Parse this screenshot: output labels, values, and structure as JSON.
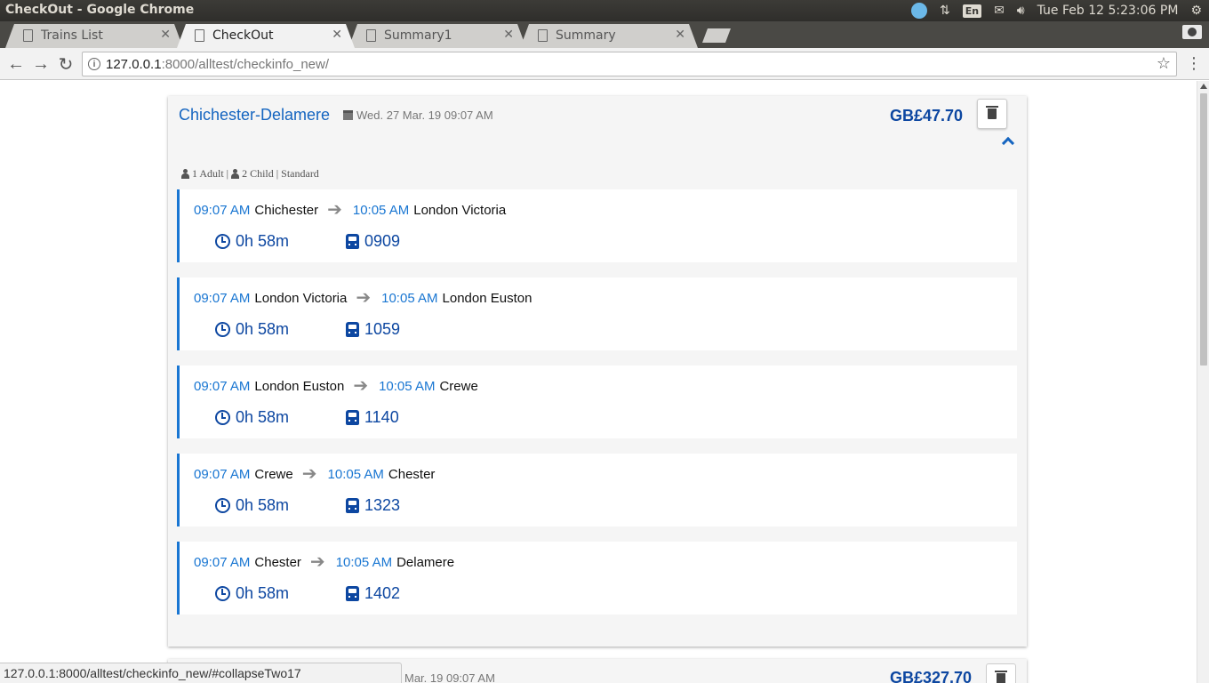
{
  "window": {
    "title": "CheckOut - Google Chrome"
  },
  "system_tray": {
    "lang": "En",
    "datetime": "Tue Feb 12  5:23:06 PM"
  },
  "tabs": [
    {
      "label": "Trains List",
      "active": false
    },
    {
      "label": "CheckOut",
      "active": true
    },
    {
      "label": "Summary1",
      "active": false
    },
    {
      "label": "Summary",
      "active": false
    }
  ],
  "toolbar": {
    "url_host": "127.0.0.1",
    "url_rest": ":8000/alltest/checkinfo_new/"
  },
  "booking": {
    "route": "Chichester-Delamere",
    "date": "Wed. 27 Mar. 19 09:07 AM",
    "price": "GB£47.70",
    "passengers": {
      "adult": "1 Adult |",
      "child": "2 Child | Standard"
    },
    "legs": [
      {
        "dep_time": "09:07 AM",
        "from": "Chichester",
        "arr_time": "10:05 AM",
        "to": "London Victoria",
        "duration": "0h 58m",
        "train": "0909"
      },
      {
        "dep_time": "09:07 AM",
        "from": "London Victoria",
        "arr_time": "10:05 AM",
        "to": "London Euston",
        "duration": "0h 58m",
        "train": "1059"
      },
      {
        "dep_time": "09:07 AM",
        "from": "London Euston",
        "arr_time": "10:05 AM",
        "to": "Crewe",
        "duration": "0h 58m",
        "train": "1140"
      },
      {
        "dep_time": "09:07 AM",
        "from": "Crewe",
        "arr_time": "10:05 AM",
        "to": "Chester",
        "duration": "0h 58m",
        "train": "1323"
      },
      {
        "dep_time": "09:07 AM",
        "from": "Chester",
        "arr_time": "10:05 AM",
        "to": "Delamere",
        "duration": "0h 58m",
        "train": "1402"
      }
    ]
  },
  "booking2": {
    "date_partial": "Mar. 19 09:07 AM",
    "price": "GB£327.70"
  },
  "status_bar": {
    "url": "127.0.0.1:8000/alltest/checkinfo_new/#collapseTwo17"
  }
}
